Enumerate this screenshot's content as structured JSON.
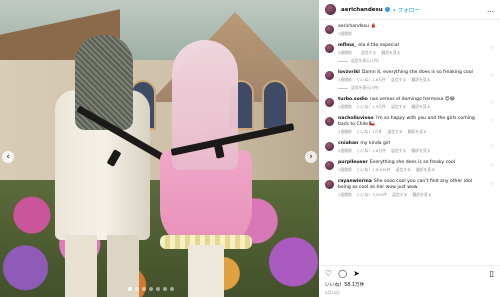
{
  "post": {
    "username": "aerichandesu",
    "follow_label": "フォロー",
    "caption": "aerichandesu 🩸",
    "caption_time": "2週間前",
    "likes": "いいね！58.1万件",
    "date": "9月23日"
  },
  "comments": [
    {
      "user": "mflma_",
      "text": "ela é tão especial",
      "time": "2週間前",
      "likes": "",
      "reply": "返信する",
      "translate": "翻訳を見る",
      "replies": "返信を表示(1件)"
    },
    {
      "user": "lovzvrikl",
      "text": "Damn it, everything she does is so freaking cool",
      "time": "2週間前",
      "likes": "いいね！1.8万件",
      "reply": "返信する",
      "translate": "翻訳を見る",
      "replies": "返信を表示(5件)"
    },
    {
      "user": "turbo.sodio",
      "text": "nos vemos el domingo hermosa 😍😂",
      "time": "2週間前",
      "likes": "いいね！1.9万件",
      "reply": "返信する",
      "translate": "翻訳を見る",
      "replies": ""
    },
    {
      "user": "nacholluvioso",
      "text": "i'm so happy with you and the girls coming back to Chile 🇨🇱",
      "time": "2週間前",
      "likes": "いいね！1万件",
      "reply": "返信する",
      "translate": "翻訳を見る",
      "replies": ""
    },
    {
      "user": "cniahan",
      "text": "my kinda girl",
      "time": "2週間前",
      "likes": "いいね！1.8万件",
      "reply": "返信する",
      "translate": "翻訳を見る",
      "replies": ""
    },
    {
      "user": "purplleuser",
      "text": "Everything she does is so freaky cool",
      "time": "2週間前",
      "likes": "いいね！1.8,938件",
      "reply": "返信する",
      "translate": "翻訳を見る",
      "replies": ""
    },
    {
      "user": "rayanwinrina",
      "text": "She sooo cool you can't find any other idol being as cool as her wow just wow",
      "time": "2週間前",
      "likes": "いいね！3,592件",
      "reply": "返信する",
      "translate": "翻訳を見る",
      "replies": ""
    }
  ],
  "icons": [
    "heart-icon",
    "comment-icon",
    "share-icon",
    "bookmark-icon"
  ]
}
